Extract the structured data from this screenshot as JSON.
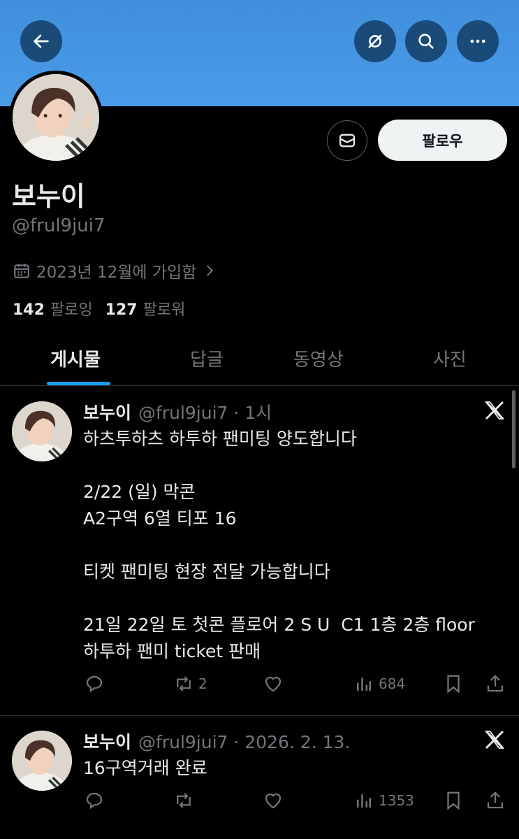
{
  "profile": {
    "display_name": "보누이",
    "handle": "@frul9jui7",
    "joined": "2023년 12월에 가입함",
    "following_count": "142",
    "following_label": "팔로잉",
    "followers_count": "127",
    "followers_label": "팔로워",
    "follow_label": "팔로우"
  },
  "tabs": [
    {
      "label": "게시물",
      "active": true
    },
    {
      "label": "답글",
      "active": false
    },
    {
      "label": "동영상",
      "active": false
    },
    {
      "label": "사진",
      "active": false
    }
  ],
  "posts": [
    {
      "name": "보누이",
      "meta": "@frul9jui7 · 1시",
      "body": "하츠투하츠 하투하 팬미팅 양도합니다\n\n2/22 (일) 막콘\nA2구역 6열 티포 16\n\n티켓 팬미팅 현장 전달 가능합니다\n\n21일 22일 토 첫콘 플로어 2 S U  C1 1층 2층 floor\n하투하 팬미 ticket 판매",
      "retweets": "2",
      "views": "684"
    },
    {
      "name": "보누이",
      "meta": "@frul9jui7 · 2026. 2. 13.",
      "body": "16구역거래 완료",
      "retweets": "",
      "views": "1353"
    }
  ],
  "icons": {
    "back": "arrow-left-icon",
    "nofollow": "slashed-circle-icon",
    "search": "search-icon",
    "more": "more-icon",
    "message": "envelope-icon",
    "calendar": "calendar-icon"
  },
  "colors": {
    "banner": "#4a9be8",
    "accent": "#1d9bf0",
    "muted": "#71767b"
  }
}
